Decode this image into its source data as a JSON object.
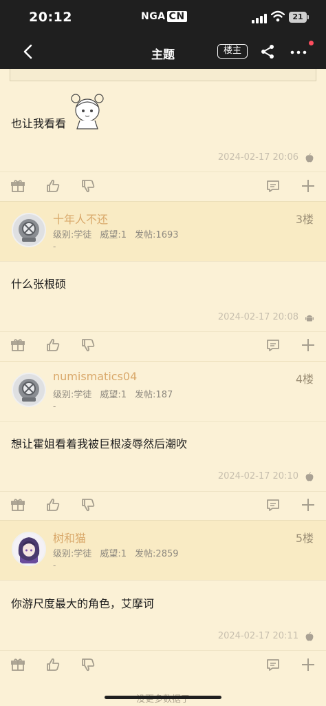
{
  "status_bar": {
    "time": "20:12",
    "brand": "NGA",
    "brand_suffix": "CN",
    "battery": "21"
  },
  "nav": {
    "title": "主题",
    "owner_label": "楼主"
  },
  "first_post": {
    "content": "也让我看看",
    "time": "2024-02-17 20:06",
    "os": "apple-icon"
  },
  "posts": [
    {
      "username": "十年人不还",
      "floor": "3楼",
      "level": "级别:学徒",
      "prestige": "威望:1",
      "posts_count": "发帖:1693",
      "dash": "-",
      "content": "什么张根硕",
      "time": "2024-02-17 20:08",
      "os": "android-icon"
    },
    {
      "username": "numismatics04",
      "floor": "4楼",
      "level": "级别:学徒",
      "prestige": "威望:1",
      "posts_count": "发帖:187",
      "dash": "-",
      "content": "想让霍姐看着我被巨根凌辱然后潮吹",
      "time": "2024-02-17 20:10",
      "os": "apple-icon"
    },
    {
      "username": "树和猫",
      "floor": "5楼",
      "level": "级别:学徒",
      "prestige": "威望:1",
      "posts_count": "发帖:2859",
      "dash": "-",
      "content": "你游尺度最大的角色，艾摩诃",
      "time": "2024-02-17 20:11",
      "os": "apple-icon"
    }
  ],
  "footer": {
    "text": "没更多数据了"
  },
  "colors": {
    "background": "#fbf1d6",
    "header": "#1f1f1f",
    "username": "#d9a86a"
  }
}
